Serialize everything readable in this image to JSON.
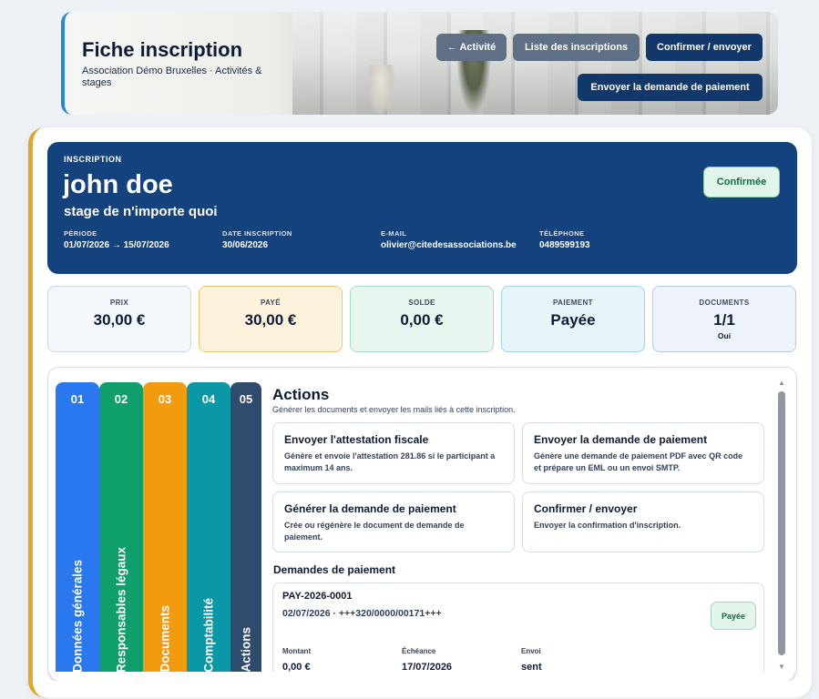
{
  "header": {
    "title": "Fiche inscription",
    "subtitle": "Association Démo Bruxelles · Activités & stages",
    "buttons": {
      "activity": "← Activité",
      "list": "Liste des inscriptions",
      "confirm_send": "Confirmer / envoyer",
      "send_payment": "Envoyer la demande de paiement"
    }
  },
  "hero": {
    "kicker": "INSCRIPTION",
    "name": "john doe",
    "activity": "stage de n'importe quoi",
    "status": "Confirmée",
    "fields": [
      {
        "label": "PÉRIODE",
        "value": "01/07/2026 → 15/07/2026"
      },
      {
        "label": "DATE INSCRIPTION",
        "value": "30/06/2026"
      },
      {
        "label": "E-MAIL",
        "value": "olivier@citedesassociations.be"
      },
      {
        "label": "TÉLÉPHONE",
        "value": "0489599193"
      }
    ]
  },
  "kpis": [
    {
      "label": "PRIX",
      "value": "30,00 €",
      "sub": "",
      "bg": "#f4f7fb",
      "border": "#cdd6e2"
    },
    {
      "label": "PAYÉ",
      "value": "30,00 €",
      "sub": "",
      "bg": "#fdf3dc",
      "border": "#ebc676"
    },
    {
      "label": "SOLDE",
      "value": "0,00 €",
      "sub": "",
      "bg": "#e7f7ef",
      "border": "#a9dcc0"
    },
    {
      "label": "PAIEMENT",
      "value": "Payée",
      "sub": "",
      "bg": "#e6f5f8",
      "border": "#9fd3de"
    },
    {
      "label": "DOCUMENTS",
      "value": "1/1",
      "sub": "Oui",
      "bg": "#eef3fb",
      "border": "#b8c9e4"
    }
  ],
  "tabs": [
    {
      "num": "01",
      "label": "Données générales",
      "color": "#2a78f0"
    },
    {
      "num": "02",
      "label": "Responsables légaux",
      "color": "#0f9f6b"
    },
    {
      "num": "03",
      "label": "Documents",
      "color": "#f29b0f"
    },
    {
      "num": "04",
      "label": "Comptabilité",
      "color": "#0a97a6"
    },
    {
      "num": "05",
      "label": "Actions",
      "color": "#2f4c6e"
    }
  ],
  "actions": {
    "title": "Actions",
    "subtitle": "Générer les documents et envoyer les mails liés à cette inscription.",
    "cards": [
      {
        "title": "Envoyer l'attestation fiscale",
        "desc": "Génère et envoie l'attestation 281.86 si le participant a maximum 14 ans."
      },
      {
        "title": "Envoyer la demande de paiement",
        "desc": "Génère une demande de paiement PDF avec QR code et prépare un EML ou un envoi SMTP."
      },
      {
        "title": "Générer la demande de paiement",
        "desc": "Crée ou régénère le document de demande de paiement."
      },
      {
        "title": "Confirmer / envoyer",
        "desc": "Envoyer la confirmation d'inscription."
      }
    ]
  },
  "payment_requests": {
    "title": "Demandes de paiement",
    "items": [
      {
        "ref": "PAY-2026-0001",
        "meta": "02/07/2026 · +++320/0000/00171+++",
        "status": "Payée",
        "amount_label": "Montant",
        "amount": "0,00 €",
        "due_label": "Échéance",
        "due": "17/07/2026",
        "send_label": "Envoi",
        "send": "sent"
      }
    ]
  },
  "colors": {
    "navy": "#14427c",
    "accent_gold": "#e3a728",
    "accent_blue": "#2a86d6",
    "success": "#136a3d"
  }
}
